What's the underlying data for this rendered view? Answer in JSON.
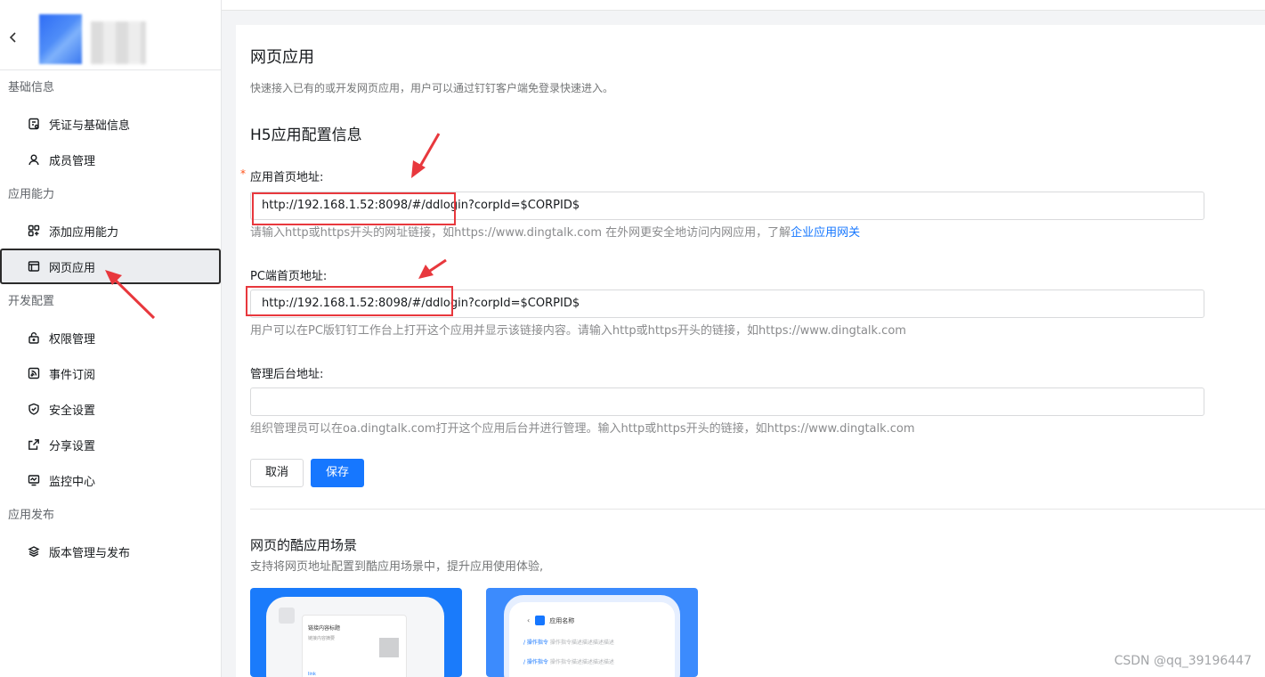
{
  "sidebar": {
    "groups": [
      {
        "title": "基础信息",
        "items": [
          {
            "label": "凭证与基础信息",
            "icon": "credential-icon"
          },
          {
            "label": "成员管理",
            "icon": "user-icon"
          }
        ]
      },
      {
        "title": "应用能力",
        "items": [
          {
            "label": "添加应用能力",
            "icon": "add-grid-icon"
          },
          {
            "label": "网页应用",
            "icon": "browser-icon",
            "active": true
          }
        ]
      },
      {
        "title": "开发配置",
        "items": [
          {
            "label": "权限管理",
            "icon": "lock-icon"
          },
          {
            "label": "事件订阅",
            "icon": "rss-icon"
          },
          {
            "label": "安全设置",
            "icon": "shield-icon"
          },
          {
            "label": "分享设置",
            "icon": "share-icon"
          },
          {
            "label": "监控中心",
            "icon": "monitor-icon"
          }
        ]
      },
      {
        "title": "应用发布",
        "items": [
          {
            "label": "版本管理与发布",
            "icon": "layers-icon"
          }
        ]
      }
    ]
  },
  "main": {
    "title": "网页应用",
    "description": "快速接入已有的或开发网页应用，用户可以通过钉钉客户端免登录快速进入。",
    "section_title": "H5应用配置信息",
    "fields": {
      "home": {
        "required_mark": "*",
        "label": "应用首页地址:",
        "value": "http://192.168.1.52:8098/#/ddlogin?corpId=$CORPID$",
        "hint": "请输入http或https开头的网址链接，如https://www.dingtalk.com 在外网更安全地访问内网应用，了解",
        "hint_link": "企业应用网关"
      },
      "pc": {
        "label": "PC端首页地址:",
        "value": "http://192.168.1.52:8098/#/ddlogin?corpId=$CORPID$",
        "hint": "用户可以在PC版钉钉工作台上打开这个应用并显示该链接内容。请输入http或https开头的链接，如https://www.dingtalk.com"
      },
      "admin": {
        "label": "管理后台地址:",
        "value": "",
        "hint": "组织管理员可以在oa.dingtalk.com打开这个应用后台并进行管理。输入http或https开头的链接，如https://www.dingtalk.com"
      }
    },
    "buttons": {
      "cancel": "取消",
      "save": "保存"
    },
    "scene": {
      "title": "网页的酷应用场景",
      "description": "支持将网页地址配置到酷应用场景中，提升应用使用体验,",
      "card1": {
        "title": "链接内容标题",
        "subtitle": "链接内容摘要",
        "link": "link"
      },
      "card2": {
        "app_name": "应用名称",
        "rows": [
          {
            "cmd": "/ 操作指令",
            "desc": "操作指令描述描述描述描述"
          },
          {
            "cmd": "/ 操作指令",
            "desc": "操作指令描述描述描述描述"
          }
        ]
      }
    }
  },
  "watermark": "CSDN @qq_39196447",
  "colors": {
    "accent": "#1677ff",
    "annotation": "#e8383d"
  }
}
